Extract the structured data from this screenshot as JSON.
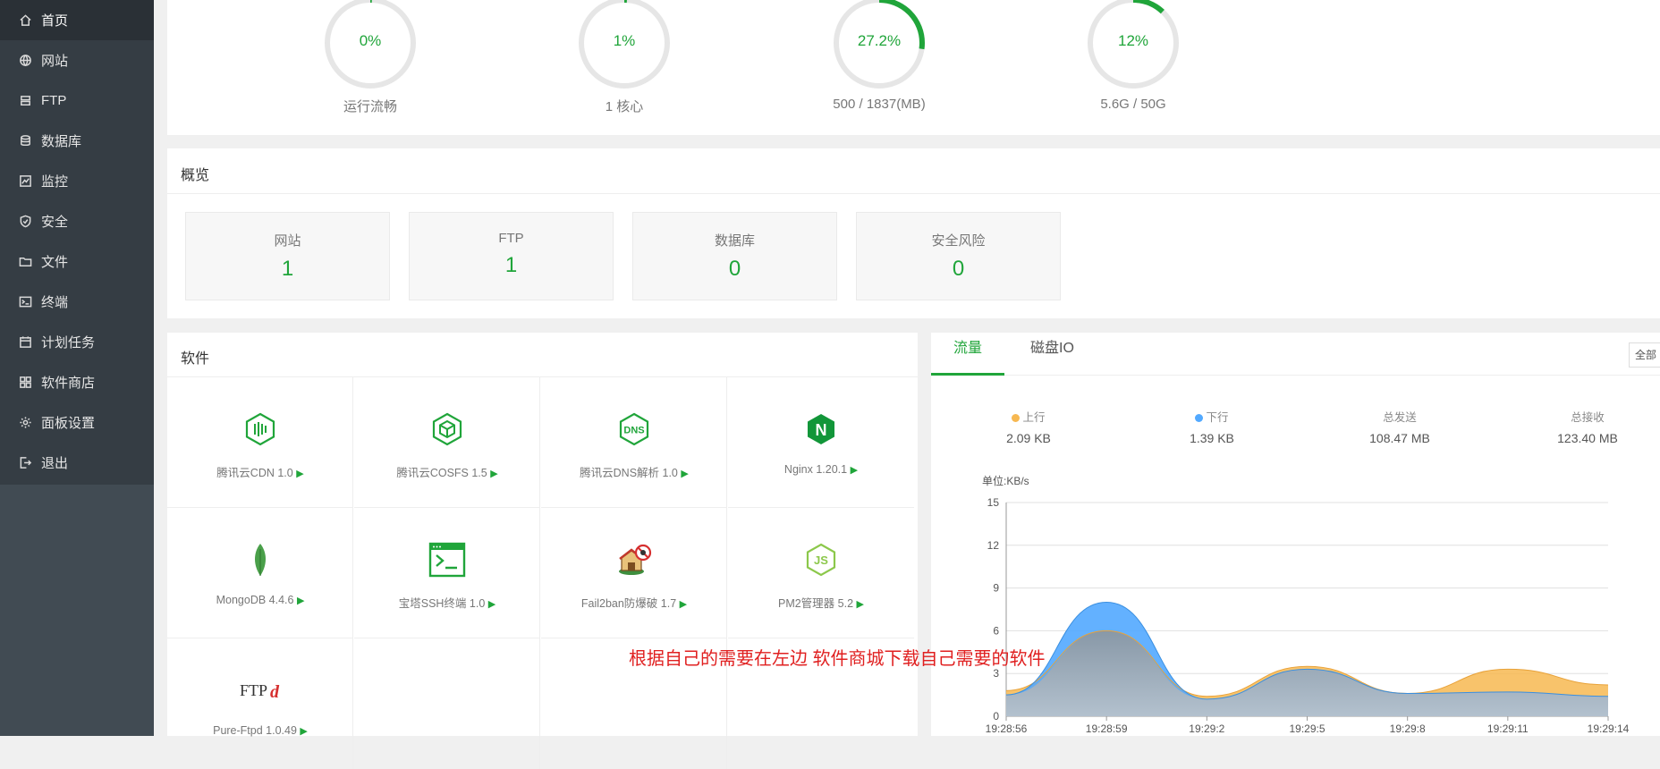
{
  "sidebar": {
    "items": [
      {
        "label": "首页",
        "icon": "home-icon"
      },
      {
        "label": "网站",
        "icon": "globe-icon"
      },
      {
        "label": "FTP",
        "icon": "ftp-icon"
      },
      {
        "label": "数据库",
        "icon": "database-icon"
      },
      {
        "label": "监控",
        "icon": "monitor-icon"
      },
      {
        "label": "安全",
        "icon": "shield-icon"
      },
      {
        "label": "文件",
        "icon": "folder-icon"
      },
      {
        "label": "终端",
        "icon": "terminal-icon"
      },
      {
        "label": "计划任务",
        "icon": "calendar-icon"
      },
      {
        "label": "软件商店",
        "icon": "apps-icon"
      },
      {
        "label": "面板设置",
        "icon": "gear-icon"
      },
      {
        "label": "退出",
        "icon": "logout-icon"
      }
    ]
  },
  "status": {
    "gauges": [
      {
        "value": "0%",
        "label": "运行流畅",
        "percent": 0
      },
      {
        "value": "1%",
        "label": "1 核心",
        "percent": 1
      },
      {
        "value": "27.2%",
        "label": "500 / 1837(MB)",
        "percent": 27.2
      },
      {
        "value": "12%",
        "label": "5.6G / 50G",
        "percent": 12
      }
    ]
  },
  "overview": {
    "title": "概览",
    "cards": [
      {
        "label": "网站",
        "value": "1"
      },
      {
        "label": "FTP",
        "value": "1"
      },
      {
        "label": "数据库",
        "value": "0"
      },
      {
        "label": "安全风险",
        "value": "0"
      }
    ]
  },
  "software": {
    "title": "软件",
    "items": [
      {
        "name": "腾讯云CDN 1.0",
        "icon": "tencent-cdn-icon"
      },
      {
        "name": "腾讯云COSFS 1.5",
        "icon": "tencent-cosfs-icon"
      },
      {
        "name": "腾讯云DNS解析 1.0",
        "icon": "tencent-dns-icon",
        "icon_text": "DNS"
      },
      {
        "name": "Nginx 1.20.1",
        "icon": "nginx-icon",
        "icon_text": "N"
      },
      {
        "name": "MongoDB 4.4.6",
        "icon": "mongodb-leaf-icon"
      },
      {
        "name": "宝塔SSH终端 1.0",
        "icon": "ssh-terminal-icon"
      },
      {
        "name": "Fail2ban防爆破 1.7",
        "icon": "fail2ban-icon"
      },
      {
        "name": "PM2管理器 5.2",
        "icon": "nodejs-icon",
        "icon_text": "JS"
      },
      {
        "name": "Pure-Ftpd 1.0.49",
        "icon": "ftpd-icon",
        "icon_text": "FTP",
        "icon_text_accent": "d"
      }
    ]
  },
  "traffic": {
    "tabs": [
      "流量",
      "磁盘IO"
    ],
    "select_label": "全部",
    "stats": [
      {
        "label": "上行",
        "value": "2.09 KB",
        "dot_color": "#f7b851"
      },
      {
        "label": "下行",
        "value": "1.39 KB",
        "dot_color": "#52a9ff"
      },
      {
        "label": "总发送",
        "value": "108.47 MB"
      },
      {
        "label": "总接收",
        "value": "123.40 MB"
      }
    ],
    "unit_label": "单位:KB/s"
  },
  "chart_data": {
    "type": "area",
    "ylabel": "单位:KB/s",
    "ylim": [
      0,
      15
    ],
    "yticks": [
      "0",
      "3",
      "6",
      "9",
      "12",
      "15"
    ],
    "x": [
      "19:28:56",
      "19:28:59",
      "19:29:2",
      "19:29:5",
      "19:29:8",
      "19:29:11",
      "19:29:14"
    ],
    "series": [
      {
        "name": "上行",
        "color": "#f7b851",
        "values": [
          1.8,
          6.0,
          1.4,
          3.5,
          1.6,
          3.3,
          2.2
        ]
      },
      {
        "name": "下行",
        "color": "#52a9ff",
        "values": [
          1.5,
          8.0,
          1.2,
          3.3,
          1.6,
          1.7,
          1.4
        ]
      }
    ],
    "grid": true
  },
  "annotation": "根据自己的需要在左边  软件商城下载自己需要的软件",
  "colors": {
    "accent": "#20a53a",
    "sidebar": "#353d44"
  }
}
